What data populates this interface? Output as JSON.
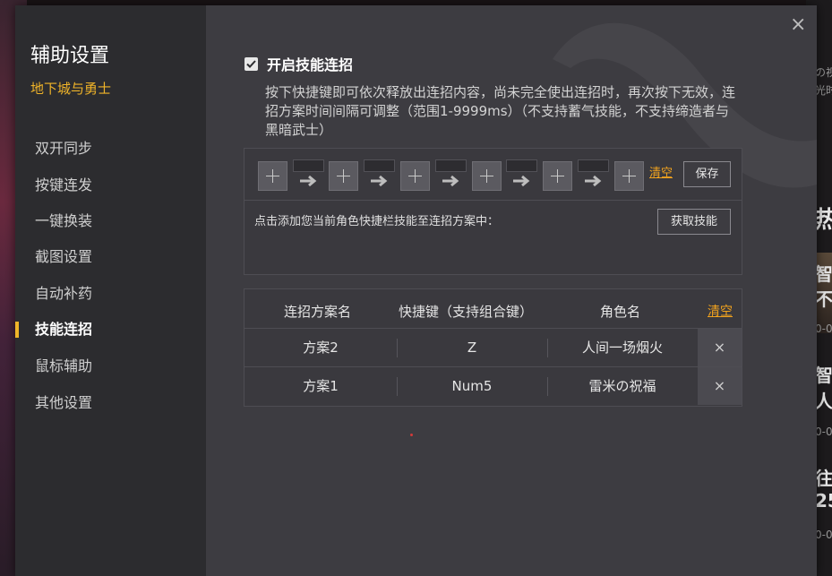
{
  "background": {
    "snippets": [
      "の视",
      "光时",
      "热",
      "智雪",
      "不你",
      "0-0",
      "智雪",
      "人也",
      "0-0",
      "往揪",
      "25",
      "0-0"
    ]
  },
  "dialog": {
    "close_label": "×"
  },
  "sidebar": {
    "title": "辅助设置",
    "subtitle": "地下城与勇士",
    "items": [
      {
        "label": "双开同步",
        "active": false
      },
      {
        "label": "按键连发",
        "active": false
      },
      {
        "label": "一键换装",
        "active": false
      },
      {
        "label": "截图设置",
        "active": false
      },
      {
        "label": "自动补药",
        "active": false
      },
      {
        "label": "技能连招",
        "active": true
      },
      {
        "label": "鼠标辅助",
        "active": false
      },
      {
        "label": "其他设置",
        "active": false
      }
    ]
  },
  "combo": {
    "enable_label": "开启技能连招",
    "enabled": true,
    "description": "按下快捷键即可依次释放出连招内容，尚未完全使出连招时，再次按下无效，连招方案时间间隔可调整（范围1-9999ms）（不支持蓄气技能，不支持缔造者与黑暗武士）",
    "clear_label": "清空",
    "save_label": "保存",
    "hint": "点击添加您当前角色快捷栏技能至连招方案中：",
    "get_skills_label": "获取技能"
  },
  "table": {
    "headers": [
      "连招方案名",
      "快捷键（支持组合键）",
      "角色名"
    ],
    "clear_label": "清空",
    "rows": [
      {
        "name": "方案2",
        "hotkey": "Z",
        "role": "人间一场烟火",
        "delete": "×"
      },
      {
        "name": "方案1",
        "hotkey": "Num5",
        "role": "雷米の祝福",
        "delete": "×"
      }
    ]
  },
  "colors": {
    "accent": "#f0b429",
    "link": "#f0a21e",
    "dialog_bg": "#3d3c41",
    "sidebar_bg": "#2c2c2f"
  }
}
